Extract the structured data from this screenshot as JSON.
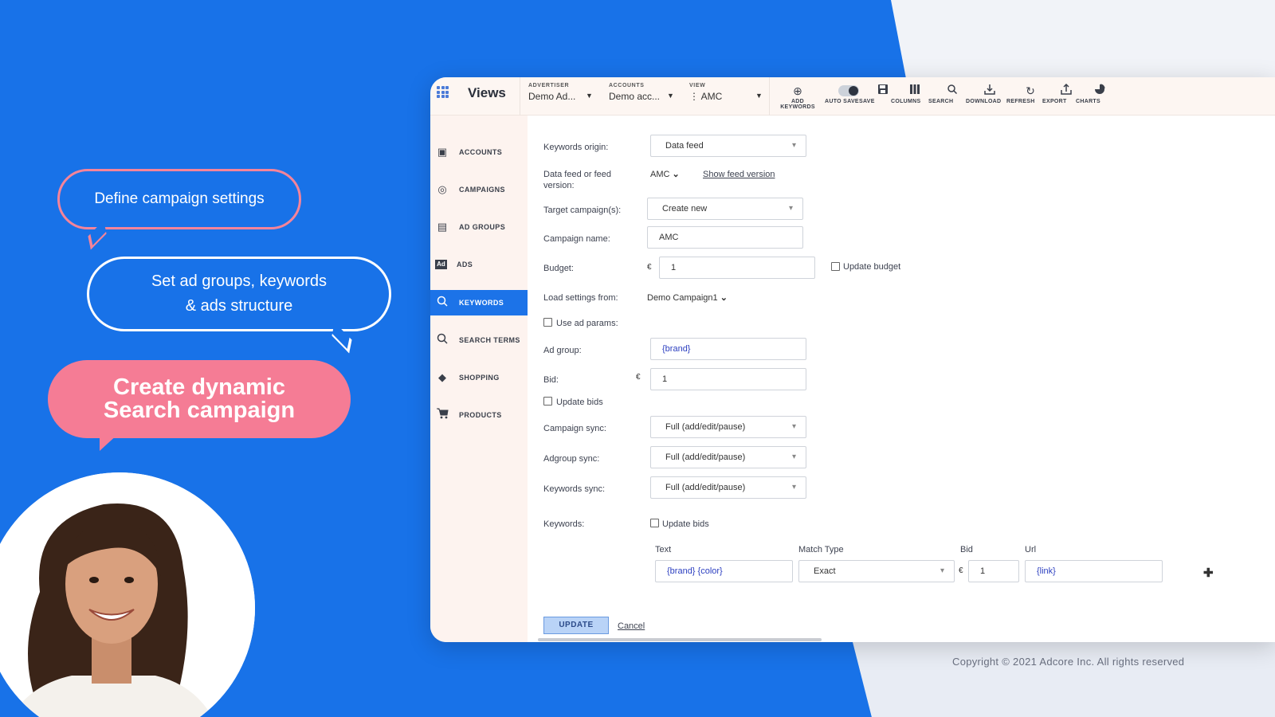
{
  "marketing": {
    "bubble1": "Define campaign settings",
    "bubble2_line1": "Set ad groups, keywords",
    "bubble2_line2": "& ads structure",
    "bubble3_line1": "Create dynamic",
    "bubble3_line2": "Search campaign",
    "copyright": "Copyright © 2021 Adcore Inc. All rights reserved"
  },
  "header": {
    "title": "Views",
    "advertiser": {
      "label": "ADVERTISER",
      "value": "Demo Ad..."
    },
    "accounts": {
      "label": "ACCOUNTS",
      "value": "Demo acc..."
    },
    "view": {
      "label": "VIEW",
      "value": "⋮ AMC"
    },
    "tools": [
      {
        "label": "ADD KEYWORDS",
        "icon": "add-circle-icon"
      },
      {
        "label": "AUTO SAVE",
        "icon": "toggle-icon"
      },
      {
        "label": "SAVE",
        "icon": "save-icon"
      },
      {
        "label": "COLUMNS",
        "icon": "columns-icon"
      },
      {
        "label": "SEARCH",
        "icon": "search-icon"
      },
      {
        "label": "DOWNLOAD",
        "icon": "download-icon"
      },
      {
        "label": "REFRESH",
        "icon": "refresh-icon"
      },
      {
        "label": "EXPORT",
        "icon": "export-icon"
      },
      {
        "label": "CHARTS",
        "icon": "pie-chart-icon"
      }
    ]
  },
  "sidebar": {
    "items": [
      {
        "label": "ACCOUNTS",
        "icon": "folder-star-icon"
      },
      {
        "label": "CAMPAIGNS",
        "icon": "target-icon"
      },
      {
        "label": "AD GROUPS",
        "icon": "stack-icon"
      },
      {
        "label": "ADS",
        "icon": "ad-icon"
      },
      {
        "label": "KEYWORDS",
        "icon": "keyword-search-icon",
        "active": true
      },
      {
        "label": "SEARCH TERMS",
        "icon": "search-terms-icon"
      },
      {
        "label": "SHOPPING",
        "icon": "tag-icon"
      },
      {
        "label": "PRODUCTS",
        "icon": "cart-icon"
      }
    ]
  },
  "form": {
    "keywords_origin": {
      "label": "Keywords origin:",
      "value": "Data feed"
    },
    "feed_version": {
      "label_line1": "Data feed or feed",
      "label_line2": "version:",
      "value": "AMC",
      "link": "Show feed version"
    },
    "target_campaigns": {
      "label": "Target campaign(s):",
      "value": "Create new"
    },
    "campaign_name": {
      "label": "Campaign name:",
      "value": "AMC"
    },
    "budget": {
      "label": "Budget:",
      "currency": "€",
      "value": "1",
      "checkbox": "Update budget"
    },
    "load_settings": {
      "label": "Load settings from:",
      "value": "Demo Campaign1"
    },
    "use_ad_params": "Use ad params:",
    "ad_group": {
      "label": "Ad group:",
      "value": "{brand}"
    },
    "bid": {
      "label": "Bid:",
      "currency": "€",
      "value": "1"
    },
    "update_bids": "Update bids",
    "campaign_sync": {
      "label": "Campaign sync:",
      "value": "Full (add/edit/pause)"
    },
    "adgroup_sync": {
      "label": "Adgroup sync:",
      "value": "Full (add/edit/pause)"
    },
    "keywords_sync": {
      "label": "Keywords sync:",
      "value": "Full (add/edit/pause)"
    },
    "keywords": {
      "label": "Keywords:",
      "checkbox": "Update bids",
      "columns": [
        "Text",
        "Match Type",
        "Bid",
        "Url"
      ],
      "row": {
        "text": "{brand} {color}",
        "match_type": "Exact",
        "currency": "€",
        "bid": "1",
        "url": "{link}"
      }
    },
    "update_button": "UPDATE",
    "cancel": "Cancel"
  }
}
